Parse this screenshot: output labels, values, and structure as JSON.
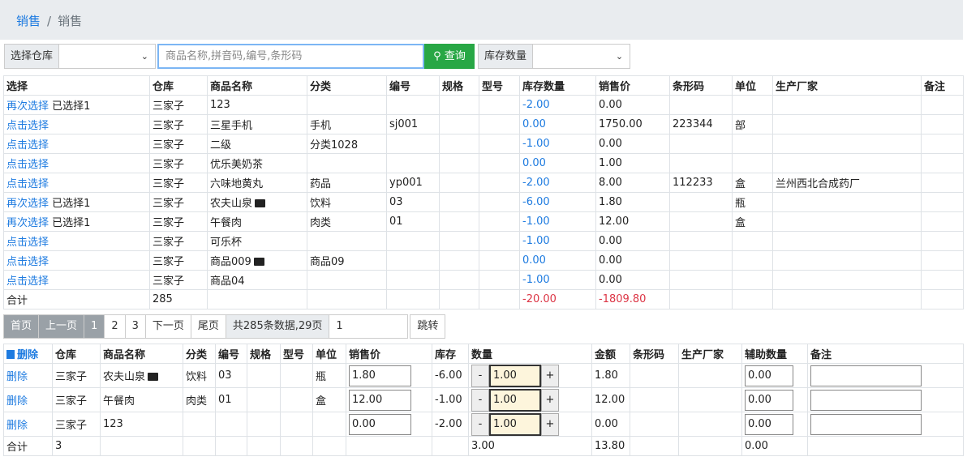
{
  "breadcrumb": {
    "parent": "销售",
    "sep": "/",
    "current": "销售"
  },
  "filter": {
    "warehouse_label": "选择仓库",
    "warehouse_value": "",
    "search_placeholder": "商品名称,拼音码,编号,条形码",
    "query_label": "查询",
    "stock_label": "库存数量",
    "stock_value": ""
  },
  "goods_headers": [
    "选择",
    "仓库",
    "商品名称",
    "分类",
    "编号",
    "规格",
    "型号",
    "库存数量",
    "销售价",
    "条形码",
    "单位",
    "生产厂家",
    "备注"
  ],
  "goods_rows": [
    {
      "sel": "再次选择",
      "tag": "已选择1",
      "wh": "三家子",
      "name": "123",
      "pic": false,
      "cat": "",
      "code": "",
      "spec": "",
      "model": "",
      "stock": "-2.00",
      "price": "0.00",
      "barcode": "",
      "unit": "",
      "maker": "",
      "note": ""
    },
    {
      "sel": "点击选择",
      "tag": "",
      "wh": "三家子",
      "name": "三星手机",
      "pic": false,
      "cat": "手机",
      "code": "sj001",
      "spec": "",
      "model": "",
      "stock": "0.00",
      "price": "1750.00",
      "barcode": "223344",
      "unit": "部",
      "maker": "",
      "note": ""
    },
    {
      "sel": "点击选择",
      "tag": "",
      "wh": "三家子",
      "name": "二级",
      "pic": false,
      "cat": "分类1028",
      "code": "",
      "spec": "",
      "model": "",
      "stock": "-1.00",
      "price": "0.00",
      "barcode": "",
      "unit": "",
      "maker": "",
      "note": ""
    },
    {
      "sel": "点击选择",
      "tag": "",
      "wh": "三家子",
      "name": "优乐美奶茶",
      "pic": false,
      "cat": "",
      "code": "",
      "spec": "",
      "model": "",
      "stock": "0.00",
      "price": "1.00",
      "barcode": "",
      "unit": "",
      "maker": "",
      "note": ""
    },
    {
      "sel": "点击选择",
      "tag": "",
      "wh": "三家子",
      "name": "六味地黄丸",
      "pic": false,
      "cat": "药品",
      "code": "yp001",
      "spec": "",
      "model": "",
      "stock": "-2.00",
      "price": "8.00",
      "barcode": "112233",
      "unit": "盒",
      "maker": "兰州西北合成药厂",
      "note": ""
    },
    {
      "sel": "再次选择",
      "tag": "已选择1",
      "wh": "三家子",
      "name": "农夫山泉",
      "pic": true,
      "cat": "饮料",
      "code": "03",
      "spec": "",
      "model": "",
      "stock": "-6.00",
      "price": "1.80",
      "barcode": "",
      "unit": "瓶",
      "maker": "",
      "note": ""
    },
    {
      "sel": "再次选择",
      "tag": "已选择1",
      "wh": "三家子",
      "name": "午餐肉",
      "pic": false,
      "cat": "肉类",
      "code": "01",
      "spec": "",
      "model": "",
      "stock": "-1.00",
      "price": "12.00",
      "barcode": "",
      "unit": "盒",
      "maker": "",
      "note": ""
    },
    {
      "sel": "点击选择",
      "tag": "",
      "wh": "三家子",
      "name": "可乐杯",
      "pic": false,
      "cat": "",
      "code": "",
      "spec": "",
      "model": "",
      "stock": "-1.00",
      "price": "0.00",
      "barcode": "",
      "unit": "",
      "maker": "",
      "note": ""
    },
    {
      "sel": "点击选择",
      "tag": "",
      "wh": "三家子",
      "name": "商品009",
      "pic": true,
      "cat": "商品09",
      "code": "",
      "spec": "",
      "model": "",
      "stock": "0.00",
      "price": "0.00",
      "barcode": "",
      "unit": "",
      "maker": "",
      "note": ""
    },
    {
      "sel": "点击选择",
      "tag": "",
      "wh": "三家子",
      "name": "商品04",
      "pic": false,
      "cat": "",
      "code": "",
      "spec": "",
      "model": "",
      "stock": "-1.00",
      "price": "0.00",
      "barcode": "",
      "unit": "",
      "maker": "",
      "note": ""
    }
  ],
  "goods_total": {
    "label": "合计",
    "count": "285",
    "stock": "-20.00",
    "price": "-1809.80"
  },
  "pagination": {
    "first": "首页",
    "prev": "上一页",
    "pages": [
      "1",
      "2",
      "3"
    ],
    "next": "下一页",
    "last": "尾页",
    "info": "共285条数据,29页",
    "jump_value": "1",
    "jump": "跳转"
  },
  "cart_headers": [
    "删除",
    "仓库",
    "商品名称",
    "分类",
    "编号",
    "规格",
    "型号",
    "单位",
    "销售价",
    "库存",
    "数量",
    "金额",
    "条形码",
    "生产厂家",
    "辅助数量",
    "备注"
  ],
  "cart_rows": [
    {
      "del": "删除",
      "wh": "三家子",
      "name": "农夫山泉",
      "pic": true,
      "cat": "饮料",
      "code": "03",
      "spec": "",
      "model": "",
      "unit": "瓶",
      "price": "1.80",
      "stock": "-6.00",
      "minus": "-",
      "qty": "1.00",
      "plus": "+",
      "amount": "1.80",
      "barcode": "",
      "maker": "",
      "aux": "0.00",
      "note": ""
    },
    {
      "del": "删除",
      "wh": "三家子",
      "name": "午餐肉",
      "pic": false,
      "cat": "肉类",
      "code": "01",
      "spec": "",
      "model": "",
      "unit": "盒",
      "price": "12.00",
      "stock": "-1.00",
      "minus": "-",
      "qty": "1.00",
      "plus": "+",
      "amount": "12.00",
      "barcode": "",
      "maker": "",
      "aux": "0.00",
      "note": ""
    },
    {
      "del": "删除",
      "wh": "三家子",
      "name": "123",
      "pic": false,
      "cat": "",
      "code": "",
      "spec": "",
      "model": "",
      "unit": "",
      "price": "0.00",
      "stock": "-2.00",
      "minus": "-",
      "qty": "1.00",
      "plus": "+",
      "amount": "0.00",
      "barcode": "",
      "maker": "",
      "aux": "0.00",
      "note": ""
    }
  ],
  "cart_total": {
    "label": "合计",
    "count": "3",
    "qty": "3.00",
    "amount": "13.80",
    "aux": "0.00"
  }
}
